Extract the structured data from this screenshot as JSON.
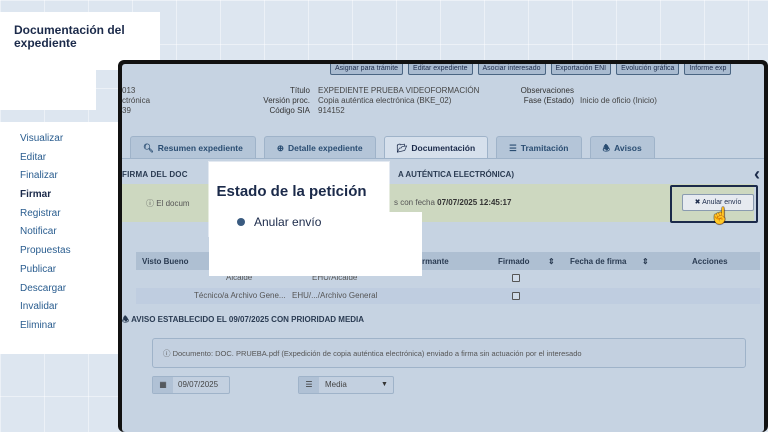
{
  "page": {
    "title": "Documentación del expediente"
  },
  "side_menu": {
    "items": [
      {
        "label": "Visualizar"
      },
      {
        "label": "Editar"
      },
      {
        "label": "Finalizar"
      },
      {
        "label": "Firmar",
        "active": true
      },
      {
        "label": "Registrar"
      },
      {
        "label": "Notificar"
      },
      {
        "label": "Propuestas"
      },
      {
        "label": "Publicar"
      },
      {
        "label": "Descargar"
      },
      {
        "label": "Invalidar"
      },
      {
        "label": "Eliminar"
      }
    ]
  },
  "toolbar": {
    "buttons": [
      {
        "label": "Asignar para trámite"
      },
      {
        "label": "Editar expediente"
      },
      {
        "label": "Asociar interesado"
      },
      {
        "label": "Exportación ENI"
      },
      {
        "label": "Evolución gráfica"
      },
      {
        "label": "Informe exp"
      }
    ]
  },
  "expediente": {
    "left_values": [
      "013",
      "ctrónica",
      "39"
    ],
    "titulo_label": "Título",
    "titulo": "EXPEDIENTE PRUEBA VIDEOFORMACIÓN",
    "version_label": "Versión proc.",
    "version": "Copia auténtica electrónica (BKE_02)",
    "sia_label": "Código SIA",
    "sia": "914152",
    "obs_label": "Observaciones",
    "fase_label": "Fase (Estado)",
    "fase": "Inicio de oficio (Inicio)"
  },
  "tabs": [
    {
      "label": "Resumen expediente",
      "icon": "search-icon"
    },
    {
      "label": "Detalle expediente",
      "icon": "search-plus-icon"
    },
    {
      "label": "Documentación",
      "icon": "folder-open-icon",
      "active": true
    },
    {
      "label": "Tramitación",
      "icon": "list-icon"
    },
    {
      "label": "Avisos",
      "icon": "bell-icon"
    }
  ],
  "firma": {
    "title_left": "FIRMA DEL DOC",
    "title_right": "A AUTÉNTICA ELECTRÓNICA)",
    "alert_left": "El docum",
    "alert_right_prefix": "s con fecha",
    "alert_date": "07/07/2025 12:45:17",
    "anular_label": "Anular envío"
  },
  "table": {
    "headers": [
      "Visto Bueno",
      "rmante",
      "Firmado",
      "Fecha de firma",
      "Acciones"
    ],
    "rows": [
      {
        "cells": [
          "Alcalde",
          "EHU/Alcalde"
        ]
      },
      {
        "cells": [
          "Técnico/a Archivo Gene...",
          "EHU/.../Archivo General"
        ]
      }
    ]
  },
  "aviso": {
    "title": "AVISO ESTABLECIDO EL 09/07/2025 CON PRIORIDAD MEDIA",
    "message": "Documento: DOC. PRUEBA.pdf (Expedición de copia auténtica electrónica) enviado a firma sin actuación por el interesado",
    "date": "09/07/2025",
    "priority": "Media"
  },
  "overlay": {
    "heading": "Estado de la petición",
    "item": "Anular envío"
  }
}
